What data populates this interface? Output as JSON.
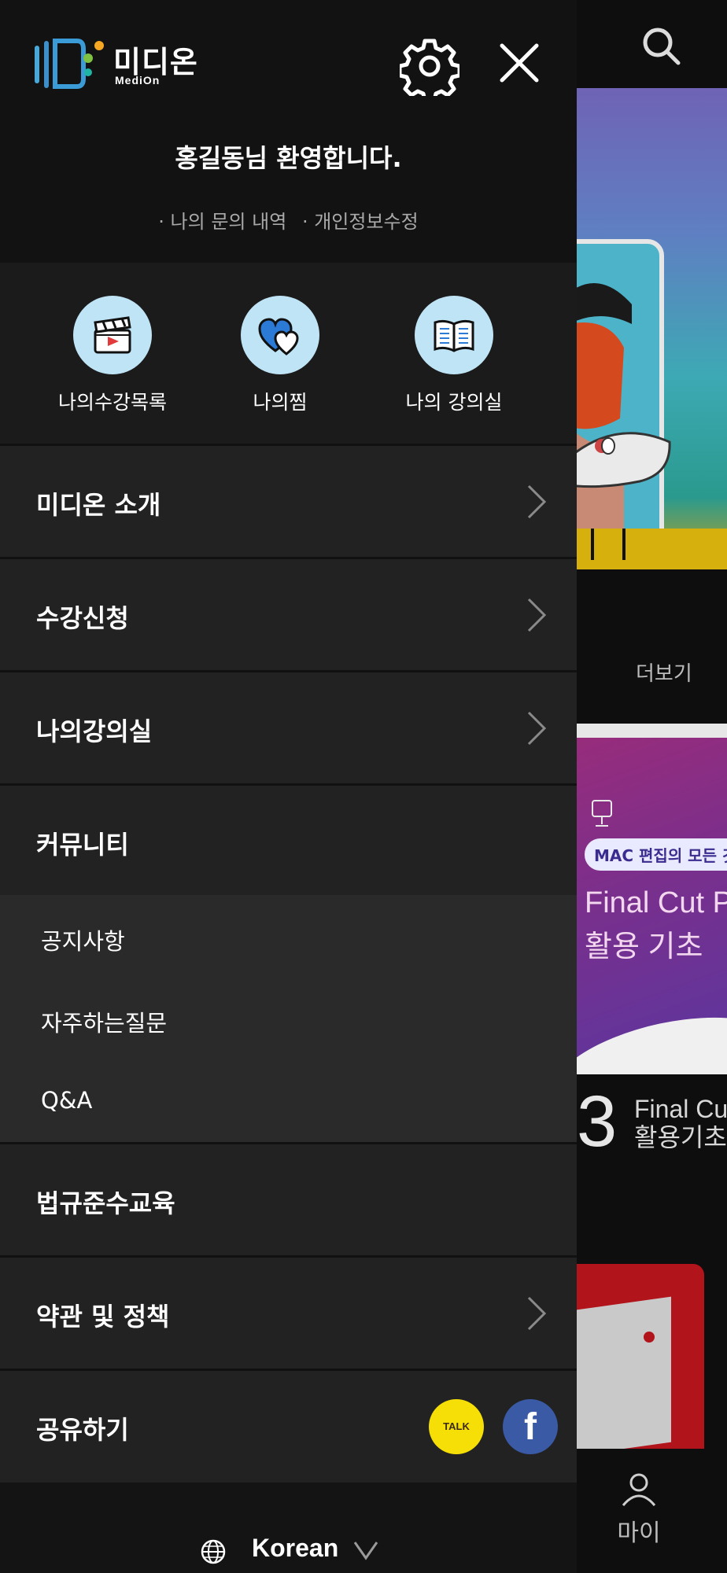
{
  "background": {
    "more_label": "더보기",
    "course": {
      "tag": "MAC 편집의 모든 것",
      "title_line1": "Final Cut Pro X",
      "title_line2": "활용 기초",
      "rank": "3",
      "name_line1": "Final Cut",
      "name_line2": "활용기초"
    },
    "bottom_nav": {
      "my_label": "마이"
    }
  },
  "drawer": {
    "logo": {
      "text": "미디온",
      "sub": "MediOn"
    },
    "welcome": "홍길동님 환영합니다.",
    "links": [
      "· 나의 문의 내역",
      "· 개인정보수정"
    ],
    "quick": [
      {
        "label": "나의수강목록",
        "icon": "clapperboard-icon"
      },
      {
        "label": "나의찜",
        "icon": "heart-icon"
      },
      {
        "label": "나의 강의실",
        "icon": "book-icon"
      }
    ],
    "menu": [
      {
        "label": "미디온 소개",
        "chevron": true
      },
      {
        "label": "수강신청",
        "chevron": true
      },
      {
        "label": "나의강의실",
        "chevron": true
      },
      {
        "label": "커뮤니티",
        "chevron": false
      }
    ],
    "community_sub": [
      "공지사항",
      "자주하는질문",
      "Q&A"
    ],
    "menu_after": [
      {
        "label": "법규준수교육",
        "chevron": false
      },
      {
        "label": "약관 및 정책",
        "chevron": true
      }
    ],
    "share": {
      "label": "공유하기",
      "kakao": "TALK",
      "facebook": "f"
    },
    "language": "Korean"
  },
  "colors": {
    "drawer_bg": "#141414",
    "row_bg": "#222222",
    "sub_bg": "#2a2a2a",
    "quick_circle": "#bfe4f6",
    "kakao": "#f5df06",
    "facebook": "#3a5aa5"
  }
}
